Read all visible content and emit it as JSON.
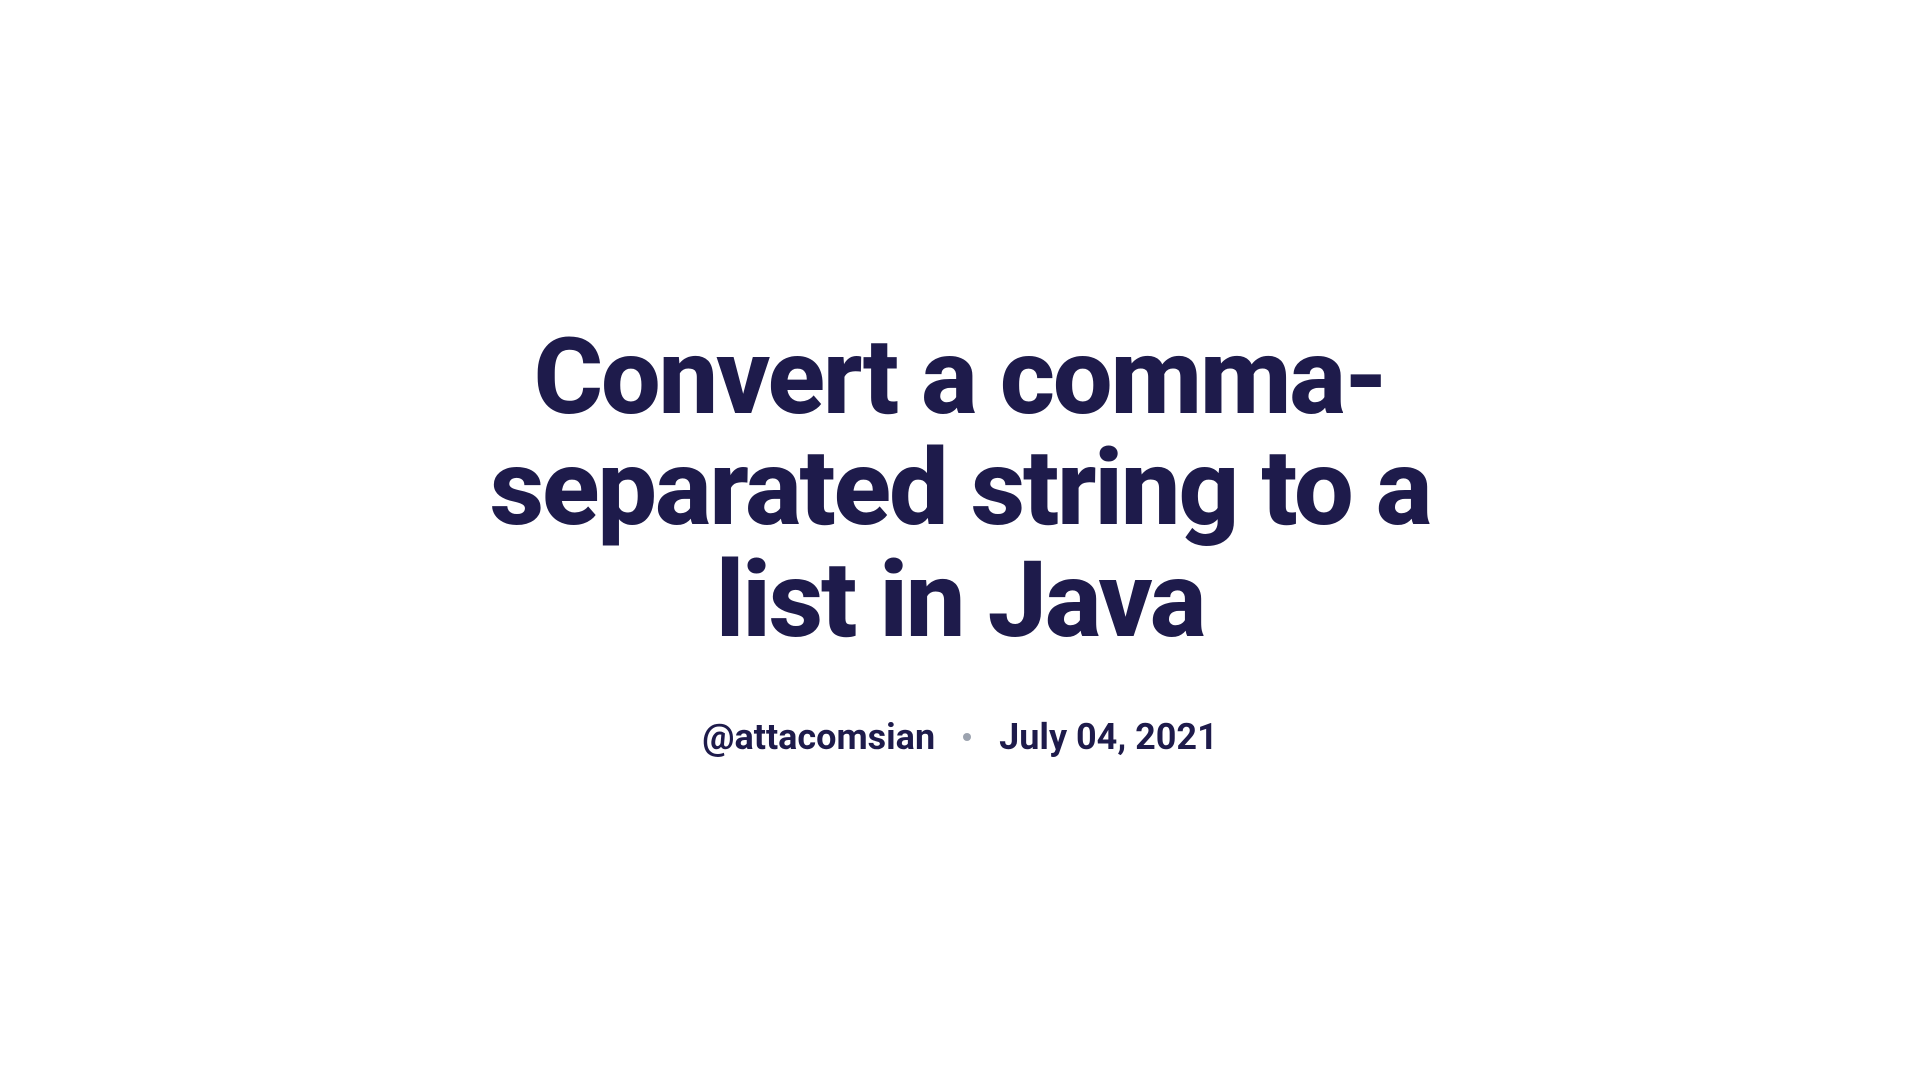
{
  "article": {
    "title": "Convert a comma-separated string to a list in Java",
    "author_handle": "@attacomsian",
    "date": "July 04, 2021"
  }
}
